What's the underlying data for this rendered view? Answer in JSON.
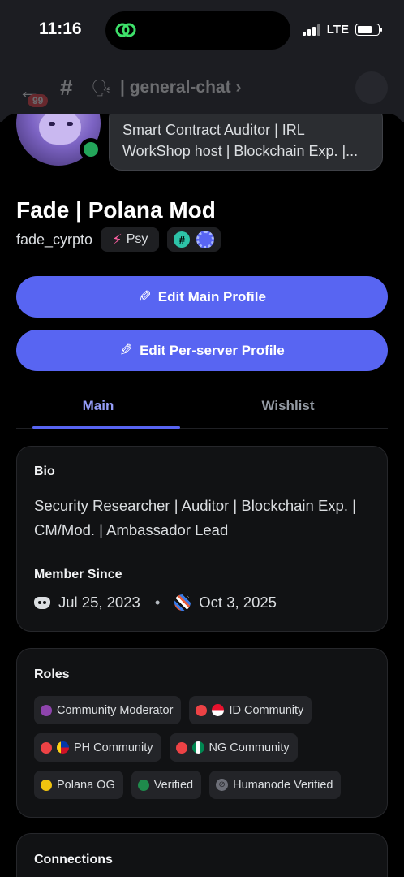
{
  "status_bar": {
    "time": "11:16",
    "network": "LTE"
  },
  "chat_header": {
    "unread_badge": "99",
    "channel": "| general-chat",
    "chevron": "›"
  },
  "profile": {
    "about_preview": [
      "Smart Contract Auditor | IRL",
      "WorkShop host | Blockchain Exp. |..."
    ],
    "display_name": "Fade | Polana Mod",
    "username": "fade_cyrpto",
    "server_tag": "Psy"
  },
  "buttons": {
    "edit_main": "Edit Main Profile",
    "edit_server": "Edit Per-server Profile"
  },
  "tabs": {
    "main": "Main",
    "wishlist": "Wishlist"
  },
  "bio": {
    "title": "Bio",
    "text": "Security Researcher | Auditor | Blockchain Exp. | CM/Mod. | Ambassador Lead",
    "member_since_title": "Member Since",
    "discord_date": "Jul 25, 2023",
    "separator": "•",
    "server_date": "Oct 3, 2025"
  },
  "roles": {
    "title": "Roles",
    "items": [
      {
        "label": "Community Moderator",
        "color": "#8e44ad"
      },
      {
        "label": "ID Community",
        "color": "#ed4245",
        "flag": "id"
      },
      {
        "label": "PH Community",
        "color": "#ed4245",
        "flag": "ph"
      },
      {
        "label": "NG Community",
        "color": "#ed4245",
        "flag": "ng"
      },
      {
        "label": "Polana OG",
        "color": "#f1c40f"
      },
      {
        "label": "Verified",
        "color": "#1f8b4c"
      },
      {
        "label": "Humanode Verified",
        "color": "#6d6f78",
        "icon": "humanode-icon"
      }
    ]
  },
  "connections": {
    "title": "Connections"
  }
}
